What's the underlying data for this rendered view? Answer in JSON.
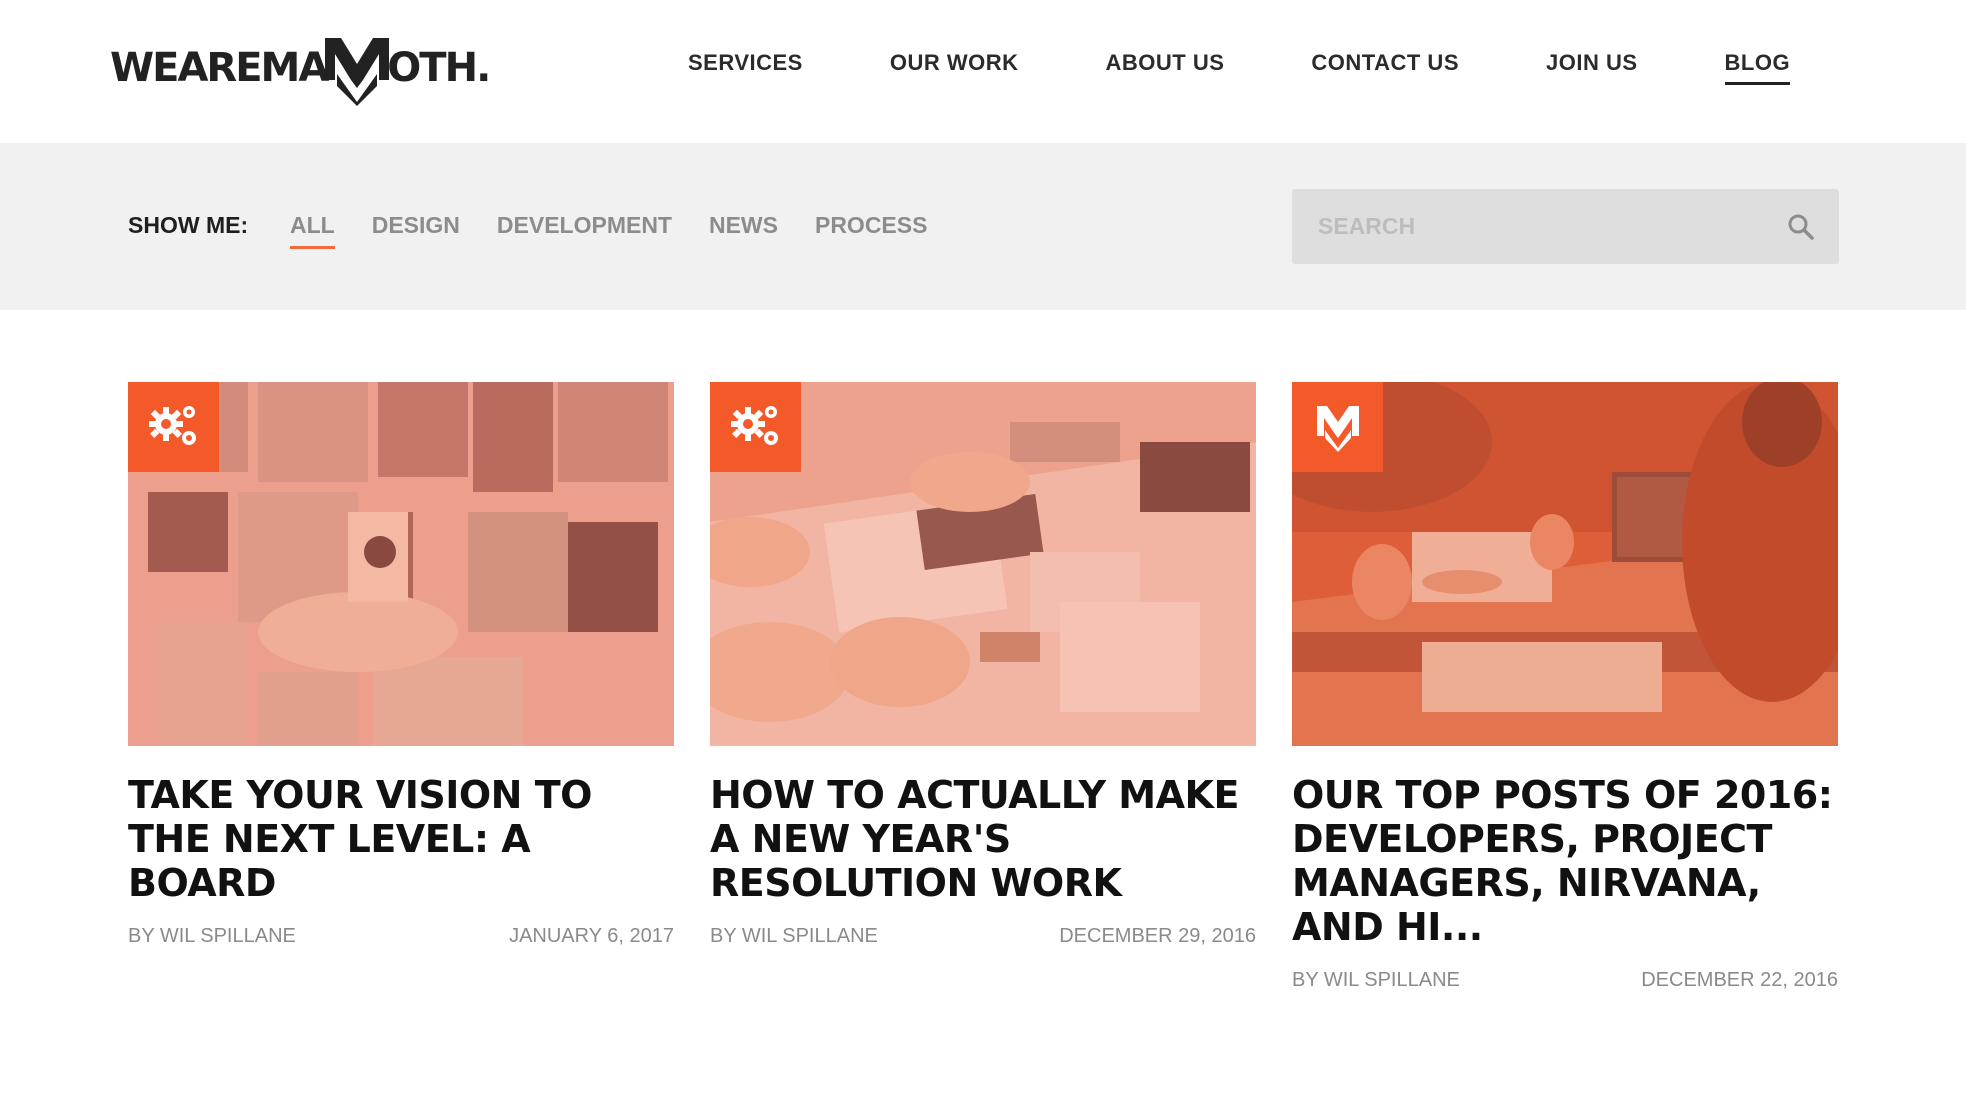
{
  "header": {
    "logo_text_before": "WEAREMA",
    "logo_text_after": "OTH.",
    "nav": [
      {
        "label": "SERVICES",
        "active": false
      },
      {
        "label": "OUR WORK",
        "active": false
      },
      {
        "label": "ABOUT US",
        "active": false
      },
      {
        "label": "CONTACT US",
        "active": false
      },
      {
        "label": "JOIN US",
        "active": false
      },
      {
        "label": "BLOG",
        "active": true
      }
    ]
  },
  "filterbar": {
    "show_me_label": "SHOW ME:",
    "filters": [
      {
        "label": "ALL",
        "active": true
      },
      {
        "label": "DESIGN",
        "active": false
      },
      {
        "label": "DEVELOPMENT",
        "active": false
      },
      {
        "label": "NEWS",
        "active": false
      },
      {
        "label": "PROCESS",
        "active": false
      }
    ],
    "search_placeholder": "SEARCH"
  },
  "posts": [
    {
      "title": "TAKE YOUR VISION TO THE NEXT LEVEL: A BOARD",
      "author": "BY WIL SPILLANE",
      "date": "JANUARY 6, 2017",
      "badge_icon": "gears-icon"
    },
    {
      "title": "HOW TO ACTUALLY MAKE A NEW YEAR'S RESOLUTION WORK",
      "author": "BY WIL SPILLANE",
      "date": "DECEMBER 29, 2016",
      "badge_icon": "gears-icon"
    },
    {
      "title": "OUR TOP POSTS OF 2016: DEVELOPERS, PROJECT MANAGERS, NIRVANA, AND HI...",
      "author": "BY WIL SPILLANE",
      "date": "DECEMBER 22, 2016",
      "badge_icon": "mammoth-m-icon"
    }
  ],
  "colors": {
    "accent": "#f4592a",
    "filter_bar_bg": "#f1f1f1",
    "search_bg": "#dedede"
  }
}
